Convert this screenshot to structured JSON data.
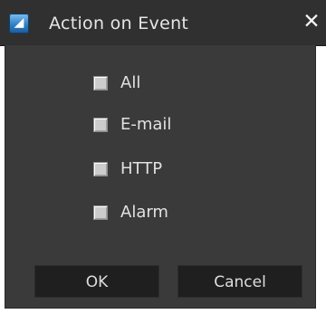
{
  "dialog": {
    "title": "Action on Event",
    "app_icon": "app-logo-icon",
    "close_icon": "close-icon",
    "close_glyph": "✕"
  },
  "options": [
    {
      "label": "All",
      "checked": false
    },
    {
      "label": "E-mail",
      "checked": false
    },
    {
      "label": "HTTP",
      "checked": false
    },
    {
      "label": "Alarm",
      "checked": false
    }
  ],
  "buttons": {
    "ok_label": "OK",
    "cancel_label": "Cancel"
  },
  "colors": {
    "titlebar": "#303030",
    "panel": "#3a3a3a",
    "button": "#1f1f1f",
    "text": "#e1e1e1"
  }
}
